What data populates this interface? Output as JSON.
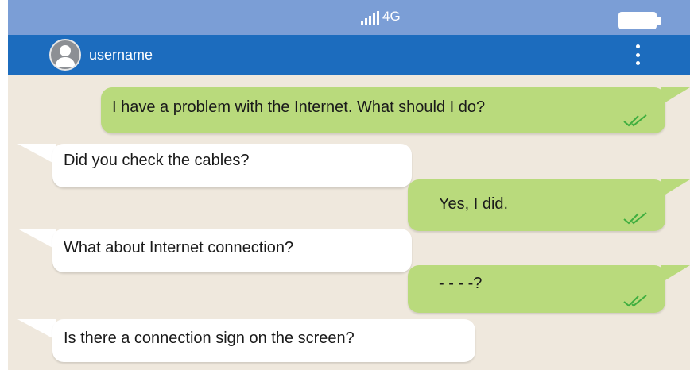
{
  "status_bar": {
    "network": "4G",
    "signal_icon": "signal-bars-icon",
    "battery_icon": "battery-icon",
    "color": "#7b9ed6"
  },
  "header": {
    "username": "username",
    "avatar_icon": "user-avatar-icon",
    "menu_icon": "kebab-menu-icon",
    "color": "#1c6cbe"
  },
  "chat": {
    "background": "#efe8dd",
    "messages": [
      {
        "direction": "outgoing",
        "text": "I have a problem with the Internet. What should I do?",
        "status": "read"
      },
      {
        "direction": "incoming",
        "text": "Did you check the cables?"
      },
      {
        "direction": "outgoing",
        "text": "Yes, I did.",
        "status": "read"
      },
      {
        "direction": "incoming",
        "text": "What about Internet connection?"
      },
      {
        "direction": "outgoing",
        "text": "- - - -?",
        "status": "read"
      },
      {
        "direction": "incoming",
        "text": "Is there a connection sign on the screen?"
      }
    ],
    "colors": {
      "incoming": "#ffffff",
      "outgoing": "#b9da7c",
      "read_check": "#3fae3f"
    }
  }
}
